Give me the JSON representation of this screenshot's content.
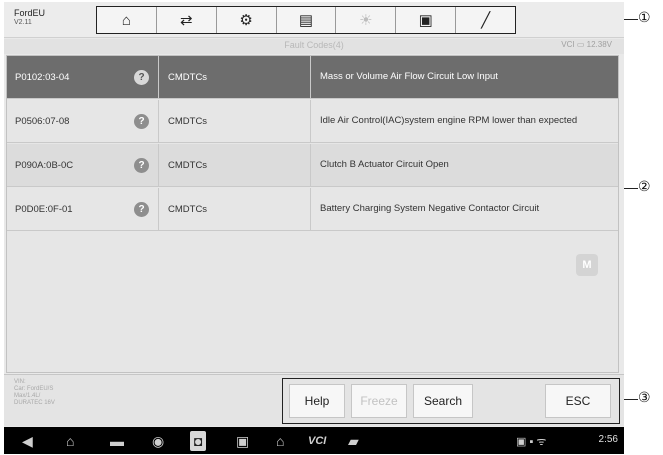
{
  "header": {
    "vehicle_name": "FordEU",
    "version": "V2.11"
  },
  "toolbar": {
    "items": [
      {
        "icon": "home-icon",
        "glyph": "⌂"
      },
      {
        "icon": "vehicle-swap-icon",
        "glyph": "⇄"
      },
      {
        "icon": "settings-gear-icon",
        "glyph": "⚙"
      },
      {
        "icon": "printer-icon",
        "glyph": "▤"
      },
      {
        "icon": "help-icon",
        "glyph": "☀"
      },
      {
        "icon": "save-icon",
        "glyph": "▣"
      },
      {
        "icon": "data-log-icon",
        "glyph": "╱"
      }
    ]
  },
  "subheader": {
    "title": "Fault Codes(4)",
    "vci": "VCI",
    "voltage": "12.38V"
  },
  "table": {
    "rows": [
      {
        "code": "P0102:03-04",
        "status": "CMDTCs",
        "description": "Mass or Volume Air Flow Circuit Low Input"
      },
      {
        "code": "P0506:07-08",
        "status": "CMDTCs",
        "description": "Idle Air Control(IAC)system engine RPM lower than expected"
      },
      {
        "code": "P090A:0B-0C",
        "status": "CMDTCs",
        "description": "Clutch B Actuator Circuit Open"
      },
      {
        "code": "P0D0E:0F-01",
        "status": "CMDTCs",
        "description": "Battery Charging System Negative Contactor Circuit"
      }
    ]
  },
  "m_badge": "M",
  "info": {
    "line1": "VIN:",
    "line2": "Car: FordEU/S",
    "line3": "Max/1.4L/",
    "line4": "DURATEC 16V"
  },
  "buttons": {
    "help": "Help",
    "freeze": "Freeze",
    "search": "Search",
    "esc": "ESC"
  },
  "navbar": {
    "vci_label": "VCI",
    "time": "2:56"
  },
  "callouts": [
    "①",
    "②",
    "③"
  ]
}
